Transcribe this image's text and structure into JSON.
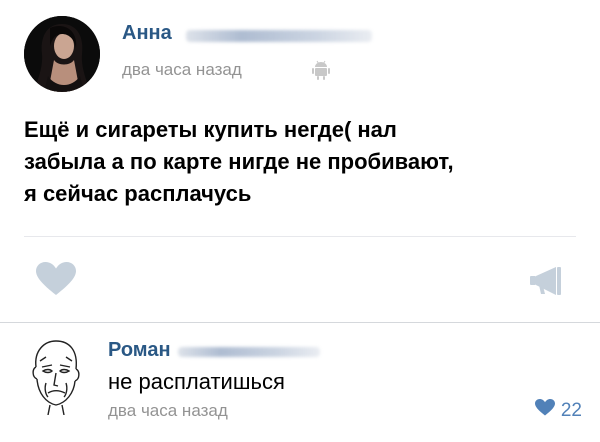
{
  "post": {
    "author": "Анна",
    "time": "два часа назад",
    "text": "Ещё и сигареты купить негде( нал\nзабыла а по карте нигде не пробивают,\nя сейчас расплачусь",
    "device_icon": "android-icon",
    "like_icon": "heart-icon",
    "share_icon": "megaphone-icon"
  },
  "comment": {
    "author": "Роман",
    "text": "не расплатишься",
    "time": "два часа назад",
    "like_icon": "heart-icon",
    "likes": "22"
  },
  "colors": {
    "link": "#2a5885",
    "meta": "#939393",
    "accent": "#5181b8",
    "icon_gray": "#c5d0db",
    "background": "#edeef0"
  }
}
